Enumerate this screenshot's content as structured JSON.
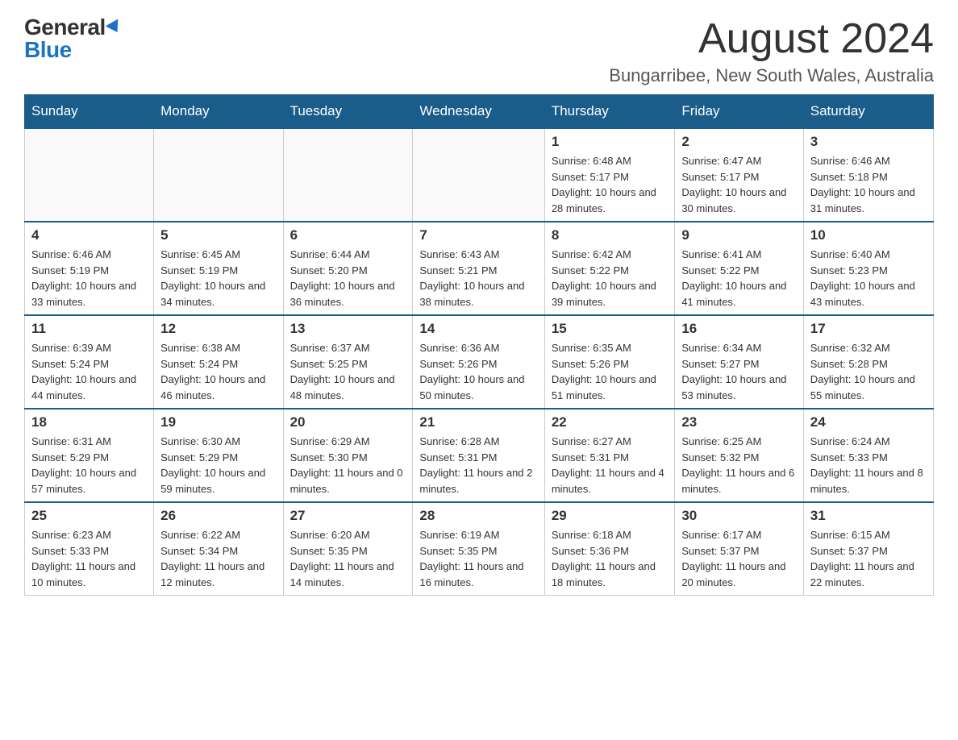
{
  "logo": {
    "general": "General",
    "blue": "Blue"
  },
  "header": {
    "month_year": "August 2024",
    "location": "Bungarribee, New South Wales, Australia"
  },
  "days_of_week": [
    "Sunday",
    "Monday",
    "Tuesday",
    "Wednesday",
    "Thursday",
    "Friday",
    "Saturday"
  ],
  "weeks": [
    [
      {
        "day": "",
        "info": ""
      },
      {
        "day": "",
        "info": ""
      },
      {
        "day": "",
        "info": ""
      },
      {
        "day": "",
        "info": ""
      },
      {
        "day": "1",
        "info": "Sunrise: 6:48 AM\nSunset: 5:17 PM\nDaylight: 10 hours and 28 minutes."
      },
      {
        "day": "2",
        "info": "Sunrise: 6:47 AM\nSunset: 5:17 PM\nDaylight: 10 hours and 30 minutes."
      },
      {
        "day": "3",
        "info": "Sunrise: 6:46 AM\nSunset: 5:18 PM\nDaylight: 10 hours and 31 minutes."
      }
    ],
    [
      {
        "day": "4",
        "info": "Sunrise: 6:46 AM\nSunset: 5:19 PM\nDaylight: 10 hours and 33 minutes."
      },
      {
        "day": "5",
        "info": "Sunrise: 6:45 AM\nSunset: 5:19 PM\nDaylight: 10 hours and 34 minutes."
      },
      {
        "day": "6",
        "info": "Sunrise: 6:44 AM\nSunset: 5:20 PM\nDaylight: 10 hours and 36 minutes."
      },
      {
        "day": "7",
        "info": "Sunrise: 6:43 AM\nSunset: 5:21 PM\nDaylight: 10 hours and 38 minutes."
      },
      {
        "day": "8",
        "info": "Sunrise: 6:42 AM\nSunset: 5:22 PM\nDaylight: 10 hours and 39 minutes."
      },
      {
        "day": "9",
        "info": "Sunrise: 6:41 AM\nSunset: 5:22 PM\nDaylight: 10 hours and 41 minutes."
      },
      {
        "day": "10",
        "info": "Sunrise: 6:40 AM\nSunset: 5:23 PM\nDaylight: 10 hours and 43 minutes."
      }
    ],
    [
      {
        "day": "11",
        "info": "Sunrise: 6:39 AM\nSunset: 5:24 PM\nDaylight: 10 hours and 44 minutes."
      },
      {
        "day": "12",
        "info": "Sunrise: 6:38 AM\nSunset: 5:24 PM\nDaylight: 10 hours and 46 minutes."
      },
      {
        "day": "13",
        "info": "Sunrise: 6:37 AM\nSunset: 5:25 PM\nDaylight: 10 hours and 48 minutes."
      },
      {
        "day": "14",
        "info": "Sunrise: 6:36 AM\nSunset: 5:26 PM\nDaylight: 10 hours and 50 minutes."
      },
      {
        "day": "15",
        "info": "Sunrise: 6:35 AM\nSunset: 5:26 PM\nDaylight: 10 hours and 51 minutes."
      },
      {
        "day": "16",
        "info": "Sunrise: 6:34 AM\nSunset: 5:27 PM\nDaylight: 10 hours and 53 minutes."
      },
      {
        "day": "17",
        "info": "Sunrise: 6:32 AM\nSunset: 5:28 PM\nDaylight: 10 hours and 55 minutes."
      }
    ],
    [
      {
        "day": "18",
        "info": "Sunrise: 6:31 AM\nSunset: 5:29 PM\nDaylight: 10 hours and 57 minutes."
      },
      {
        "day": "19",
        "info": "Sunrise: 6:30 AM\nSunset: 5:29 PM\nDaylight: 10 hours and 59 minutes."
      },
      {
        "day": "20",
        "info": "Sunrise: 6:29 AM\nSunset: 5:30 PM\nDaylight: 11 hours and 0 minutes."
      },
      {
        "day": "21",
        "info": "Sunrise: 6:28 AM\nSunset: 5:31 PM\nDaylight: 11 hours and 2 minutes."
      },
      {
        "day": "22",
        "info": "Sunrise: 6:27 AM\nSunset: 5:31 PM\nDaylight: 11 hours and 4 minutes."
      },
      {
        "day": "23",
        "info": "Sunrise: 6:25 AM\nSunset: 5:32 PM\nDaylight: 11 hours and 6 minutes."
      },
      {
        "day": "24",
        "info": "Sunrise: 6:24 AM\nSunset: 5:33 PM\nDaylight: 11 hours and 8 minutes."
      }
    ],
    [
      {
        "day": "25",
        "info": "Sunrise: 6:23 AM\nSunset: 5:33 PM\nDaylight: 11 hours and 10 minutes."
      },
      {
        "day": "26",
        "info": "Sunrise: 6:22 AM\nSunset: 5:34 PM\nDaylight: 11 hours and 12 minutes."
      },
      {
        "day": "27",
        "info": "Sunrise: 6:20 AM\nSunset: 5:35 PM\nDaylight: 11 hours and 14 minutes."
      },
      {
        "day": "28",
        "info": "Sunrise: 6:19 AM\nSunset: 5:35 PM\nDaylight: 11 hours and 16 minutes."
      },
      {
        "day": "29",
        "info": "Sunrise: 6:18 AM\nSunset: 5:36 PM\nDaylight: 11 hours and 18 minutes."
      },
      {
        "day": "30",
        "info": "Sunrise: 6:17 AM\nSunset: 5:37 PM\nDaylight: 11 hours and 20 minutes."
      },
      {
        "day": "31",
        "info": "Sunrise: 6:15 AM\nSunset: 5:37 PM\nDaylight: 11 hours and 22 minutes."
      }
    ]
  ]
}
